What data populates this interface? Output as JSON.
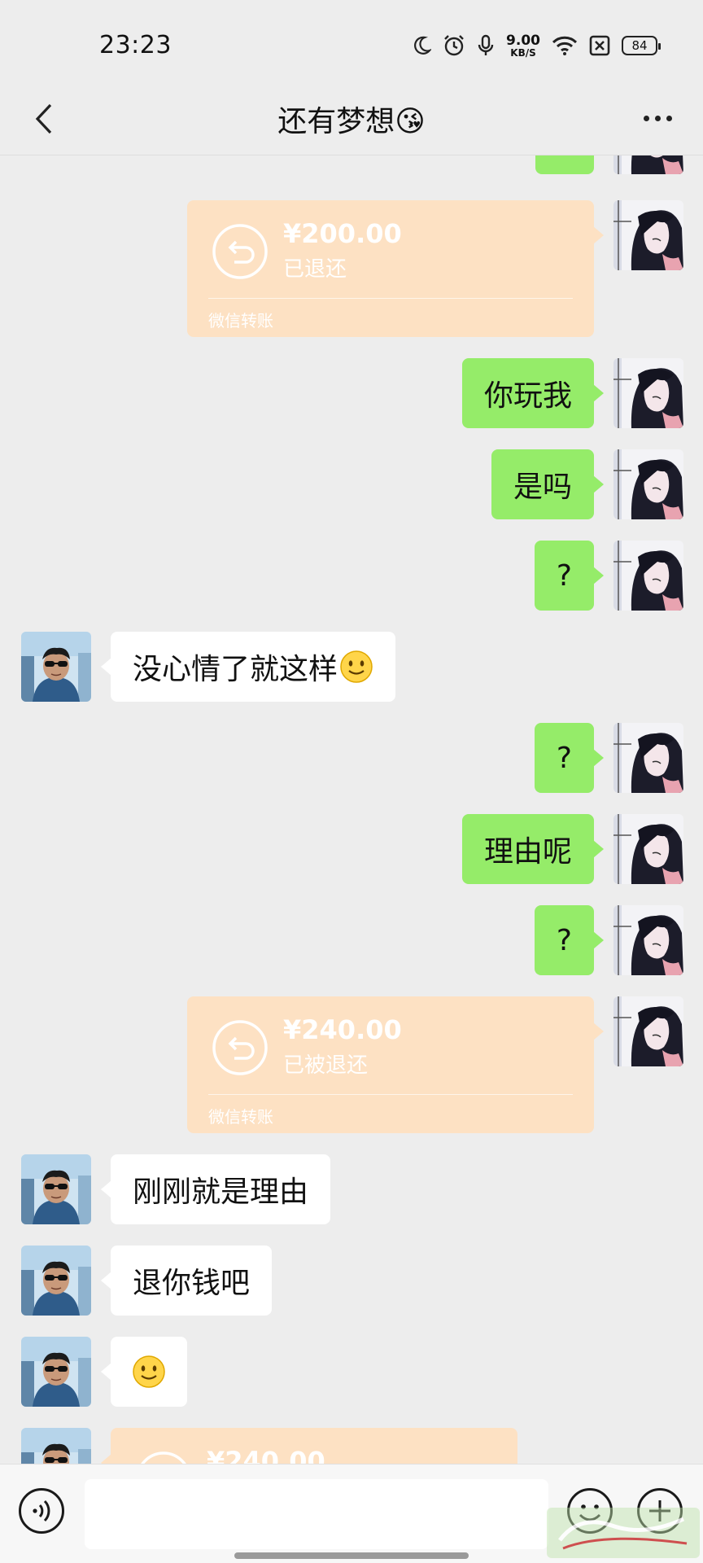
{
  "status_bar": {
    "time": "23:23",
    "net_speed_value": "9.00",
    "net_speed_unit": "KB/S",
    "battery": "84"
  },
  "header": {
    "title": "还有梦想😘"
  },
  "messages": [
    {
      "side": "me",
      "type": "text",
      "text": ""
    },
    {
      "side": "me",
      "type": "transfer",
      "amount": "¥200.00",
      "status": "已退还",
      "label": "微信转账"
    },
    {
      "side": "me",
      "type": "text",
      "text": "你玩我"
    },
    {
      "side": "me",
      "type": "text",
      "text": "是吗"
    },
    {
      "side": "me",
      "type": "text",
      "text": "?"
    },
    {
      "side": "them",
      "type": "text",
      "text": "没心情了就这样",
      "emoji": "smile"
    },
    {
      "side": "me",
      "type": "text",
      "text": "?"
    },
    {
      "side": "me",
      "type": "text",
      "text": "理由呢"
    },
    {
      "side": "me",
      "type": "text",
      "text": "?"
    },
    {
      "side": "me",
      "type": "transfer",
      "amount": "¥240.00",
      "status": "已被退还",
      "label": "微信转账"
    },
    {
      "side": "them",
      "type": "text",
      "text": "刚刚就是理由"
    },
    {
      "side": "them",
      "type": "text",
      "text": "退你钱吧"
    },
    {
      "side": "them",
      "type": "text",
      "text": "",
      "emoji": "smile"
    },
    {
      "side": "them",
      "type": "transfer",
      "amount": "¥240.00",
      "status": "",
      "label": ""
    }
  ],
  "input": {
    "value": "",
    "placeholder": ""
  },
  "icons": {
    "back": "chevron-left-icon",
    "more": "more-dots-icon",
    "voice": "voice-icon",
    "emoji": "emoji-icon",
    "plus": "plus-icon",
    "transfer_return": "return-arrow-icon"
  },
  "colors": {
    "background": "#ededed",
    "my_bubble": "#95ec69",
    "their_bubble": "#ffffff",
    "transfer_card": "#fde1c3"
  }
}
